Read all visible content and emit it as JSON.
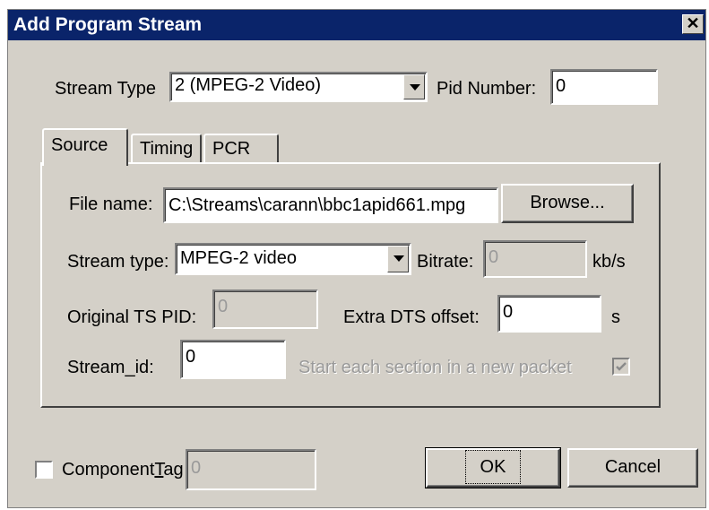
{
  "window": {
    "title": "Add Program Stream",
    "close_glyph": "✕"
  },
  "stream_type": {
    "label": "Stream Type",
    "value": "2 (MPEG-2 Video)"
  },
  "pid": {
    "label": "Pid Number:",
    "value": "0"
  },
  "tabs": [
    {
      "label": "Source"
    },
    {
      "label": "Timing"
    },
    {
      "label": "PCR"
    }
  ],
  "source": {
    "file_name_label": "File name:",
    "file_name_value": "C:\\Streams\\carann\\bbc1apid661.mpg",
    "browse_label": "Browse...",
    "stream_type_label": "Stream type:",
    "stream_type_value": "MPEG-2 video",
    "bitrate_label": "Bitrate:",
    "bitrate_value": "0",
    "bitrate_unit": "kb/s",
    "original_pid_label": "Original TS PID:",
    "original_pid_value": "0",
    "extra_dts_label": "Extra DTS offset:",
    "extra_dts_value": "0",
    "extra_dts_unit": "s",
    "stream_id_label": "Stream_id:",
    "stream_id_value": "0",
    "new_packet_label": "Start each section in a new packet",
    "new_packet_checked": true
  },
  "component_tag": {
    "label_prefix": "Component",
    "label_accel": "T",
    "label_suffix": "ag",
    "value": "0",
    "checked": false
  },
  "buttons": {
    "ok": "OK",
    "cancel": "Cancel"
  }
}
